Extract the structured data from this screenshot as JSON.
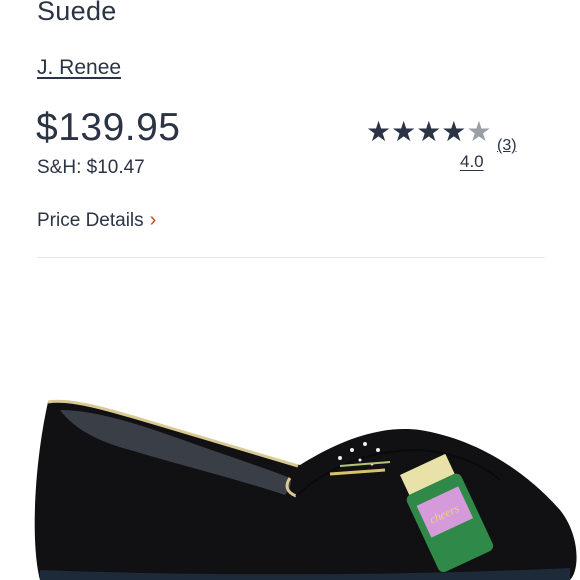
{
  "product": {
    "title": "Suede",
    "brand": "J. Renee",
    "price": "$139.95",
    "shipping": "S&H: $10.47"
  },
  "rating": {
    "stars": "★★★★",
    "empty_star": "★",
    "count": "(3)",
    "score": "4.0"
  },
  "price_details": {
    "label": "Price Details",
    "chevron": "›"
  },
  "colors": {
    "text": "#2b3444",
    "accent": "#c4461f"
  }
}
